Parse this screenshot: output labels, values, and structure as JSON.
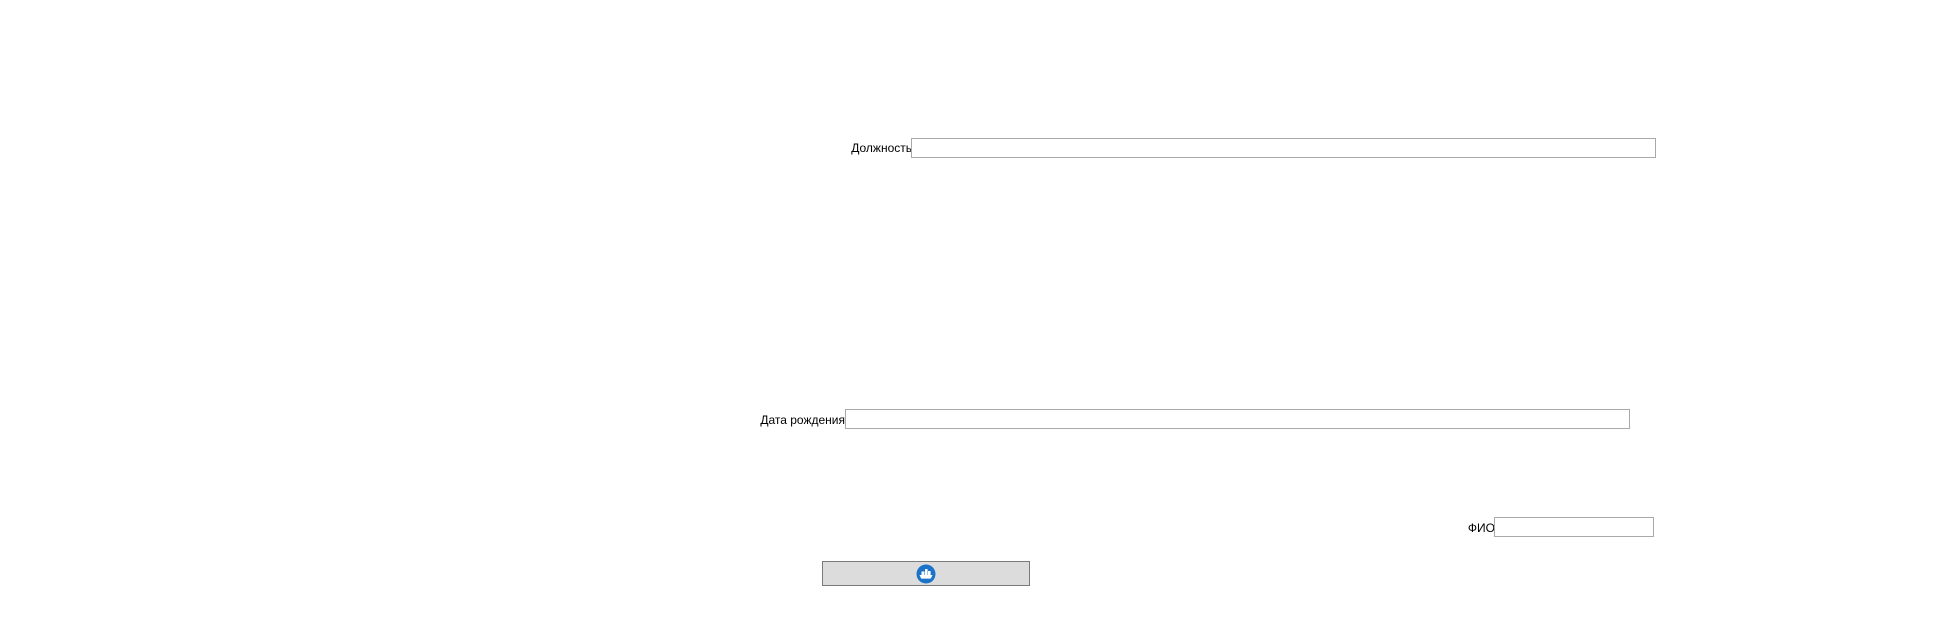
{
  "form": {
    "position": {
      "label": "Должность",
      "value": ""
    },
    "birthdate": {
      "label": "Дата рождения",
      "value": ""
    },
    "fio": {
      "label": "ФИО",
      "value": ""
    },
    "submit_button": {
      "icon": "ship-logo-icon",
      "icon_color": "#1a73c8"
    }
  }
}
